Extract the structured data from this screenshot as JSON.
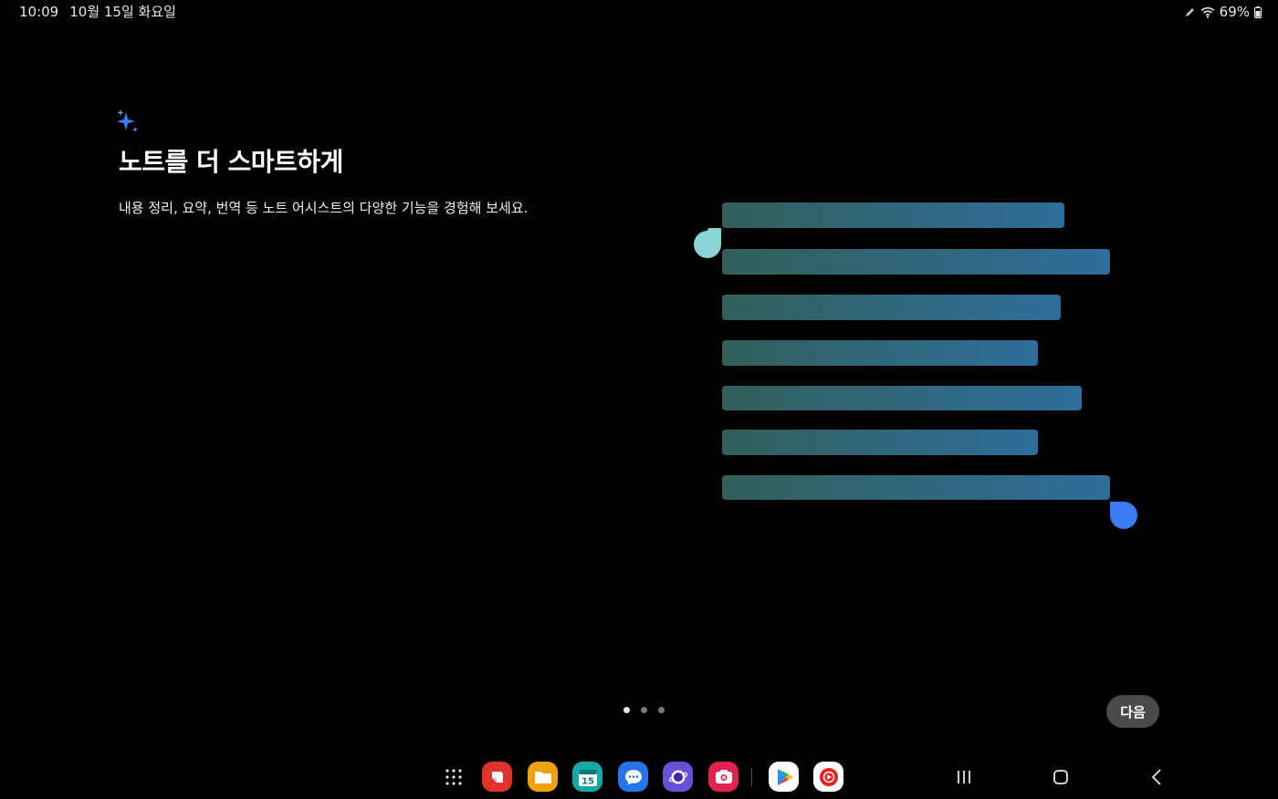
{
  "status_bar": {
    "time": "10:09",
    "date": "10월 15일 화요일",
    "battery": "69%",
    "icons": [
      "pen-icon",
      "wifi-icon",
      "battery-icon"
    ]
  },
  "intro": {
    "icon": "sparkle-icon",
    "title": "노트를 더 스마트하게",
    "subtitle": "내용 정리, 요약, 번역 등 노트 어시스트의 다양한 기능을 경험해 보세요."
  },
  "pager": {
    "count": 3,
    "active": 0
  },
  "next_button": {
    "label": "다음"
  },
  "taskbar": {
    "apps": [
      {
        "name": "samsung-notes",
        "color": "#e1332d"
      },
      {
        "name": "my-files",
        "color": "#f1a20b"
      },
      {
        "name": "calendar",
        "color": "#13a9a8",
        "label": "15"
      },
      {
        "name": "messages",
        "color": "#2574e8"
      },
      {
        "name": "samsung-internet",
        "color": "#6a4fd9"
      },
      {
        "name": "screen-recorder",
        "color": "#e2234f"
      },
      {
        "name": "play-store",
        "color": "#ffffff"
      },
      {
        "name": "youtube-music",
        "color": "#ffffff"
      }
    ],
    "nav": [
      "recents-icon",
      "home-icon",
      "back-icon"
    ]
  },
  "colors": {
    "accent_blue": "#3d7bf5",
    "accent_teal": "#8ad4d6",
    "bar_start": "#325f5a",
    "bar_end": "#2f6e9b"
  }
}
